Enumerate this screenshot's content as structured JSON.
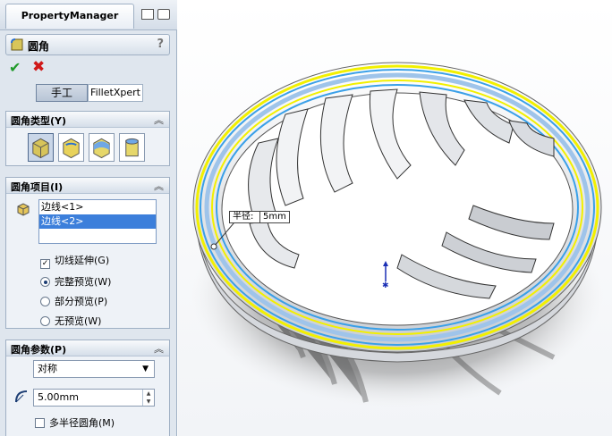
{
  "panel": {
    "tab_label": "PropertyManager",
    "feature_title": "圆角",
    "help_label": "?",
    "ok_symbol": "✔",
    "cancel_symbol": "✖",
    "mode_buttons": {
      "manual": "手工",
      "filletxpert": "FilletXpert"
    }
  },
  "fillet_type": {
    "title": "圆角类型(Y)",
    "options": [
      "constant-radius-fillet-icon",
      "variable-radius-fillet-icon",
      "face-fillet-icon",
      "full-round-fillet-icon"
    ],
    "selected_index": 0
  },
  "fillet_items": {
    "title": "圆角项目(I)",
    "list": [
      "边线<1>",
      "边线<2>"
    ],
    "selected_index": 1,
    "tangent_propagation": {
      "label": "切线延伸(G)",
      "checked": true
    },
    "preview": {
      "full": "完整预览(W)",
      "partial": "部分预览(P)",
      "none": "无预览(W)",
      "selected": "full"
    }
  },
  "fillet_params": {
    "title": "圆角参数(P)",
    "profile": "对称",
    "radius_value": "5.00mm",
    "multi_radius": {
      "label": "多半径圆角(M)",
      "checked": false
    }
  },
  "viewport": {
    "callout_label": "半径:",
    "callout_value": "5mm"
  },
  "colors": {
    "selection_yellow": "#f2f000",
    "highlight_blue": "#3aa0e8",
    "panel_bg": "#dfe6ee",
    "accept_green": "#1f9a2a",
    "cancel_red": "#d01818"
  }
}
